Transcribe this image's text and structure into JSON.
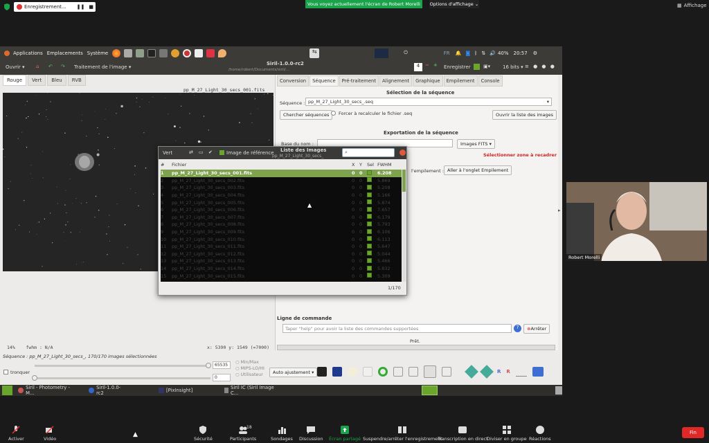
{
  "zoom": {
    "recording_label": "Enregistrement...",
    "share_banner": "Vous voyez actuellement l'écran de Robert Morelli",
    "view_options": "Options d'affichage",
    "affichage": "Affichage",
    "participant_count": "18",
    "end_label": "Fin",
    "video_name": "Robert Morelli",
    "bottom": [
      "Activer",
      "Vidéo",
      "Sécurité",
      "Participants",
      "Sondages",
      "Discussion",
      "Écran partagé",
      "Suspendre/arrêter l'enregistrement",
      "Transcription en direct",
      "Diviser en groupe",
      "Réactions"
    ]
  },
  "gnome": {
    "applications": "Applications",
    "emplacements": "Emplacements",
    "systeme": "Système",
    "lang": "FR",
    "volume": "40%",
    "clock": "20:57"
  },
  "siril": {
    "open": "Ouvrir",
    "treatment": "Traitement de l'image",
    "title": "Siril-1.0.0-rc2",
    "subtitle": "/home/robert/Documents/siril/...",
    "save": "Enregistrer",
    "bits": "16 bits",
    "channel_tabs": [
      "Rouge",
      "Vert",
      "Bleu",
      "RVB"
    ],
    "image_title": "pp_M_27_Light_30_secs_001.fits",
    "status_zoom": "14%",
    "status_fwhm": "fwhm : N/A",
    "status_coords": "x: 5390 y: 1549 (=7000)",
    "sequence_line": "Séquence : pp_M_27_Light_30_secs_, 170/170 images sélectionnées",
    "right_tabs": [
      "Conversion",
      "Séquence",
      "Pré-traitement",
      "Alignement",
      "Graphique",
      "Empilement",
      "Console"
    ],
    "sel_heading": "Sélection de la séquence",
    "seq_label": "Séquence :",
    "seq_value": "pp_M_27_Light_30_secs_.seq",
    "search_btn": "Chercher séquences",
    "force_label": "Forcer à recalculer le fichier .seq",
    "open_list_btn": "Ouvrir la liste des images",
    "export_heading": "Exportation de la séquence",
    "base_name_label": "Base du nom :",
    "fits_select": "Images FITS",
    "select_zone": "Sélectionner zone à recadrer",
    "stack_label": "l'empilement :",
    "stack_btn": "Aller à l'onglet Empilement",
    "cmd_heading": "Ligne de commande",
    "cmd_placeholder": "Taper \"help\" pour avoir la liste des commandes supportées",
    "stop_btn": "Arrêter",
    "ready": "Prêt.",
    "slider_max": "65535",
    "slider_min": "0",
    "radio_opts": [
      "Min/Max",
      "MIPS-LO/HI",
      "Utilisateur"
    ],
    "auto_adjust": "Auto ajustement",
    "tronquer": "tronquer"
  },
  "image_list": {
    "title": "Liste des Images",
    "channel": "Vert",
    "ref_label": "Image de référence",
    "subtitle": "pp_M_27_Light_30_secs_",
    "headers": [
      "#",
      "Fichier",
      "X",
      "Y",
      "Sel",
      "FWHM"
    ],
    "rows": [
      {
        "n": "1",
        "file": "pp_M_27_Light_30_secs_001.fits",
        "x": "0",
        "y": "0",
        "fwhm": "6.208",
        "sel": true
      },
      {
        "n": "2",
        "file": "pp_M_27_Light_30_secs_002.fits",
        "x": "0",
        "y": "0",
        "fwhm": "5.869",
        "sel": false
      },
      {
        "n": "3",
        "file": "pp_M_27_Light_30_secs_003.fits",
        "x": "0",
        "y": "0",
        "fwhm": "5.208",
        "sel": false
      },
      {
        "n": "4",
        "file": "pp_M_27_Light_30_secs_004.fits",
        "x": "0",
        "y": "0",
        "fwhm": "5.166",
        "sel": false
      },
      {
        "n": "5",
        "file": "pp_M_27_Light_30_secs_005.fits",
        "x": "0",
        "y": "0",
        "fwhm": "5.874",
        "sel": false
      },
      {
        "n": "6",
        "file": "pp_M_27_Light_30_secs_006.fits",
        "x": "0",
        "y": "0",
        "fwhm": "7.657",
        "sel": false
      },
      {
        "n": "7",
        "file": "pp_M_27_Light_30_secs_007.fits",
        "x": "0",
        "y": "0",
        "fwhm": "6.179",
        "sel": false
      },
      {
        "n": "8",
        "file": "pp_M_27_Light_30_secs_008.fits",
        "x": "0",
        "y": "0",
        "fwhm": "5.793",
        "sel": false
      },
      {
        "n": "9",
        "file": "pp_M_27_Light_30_secs_009.fits",
        "x": "0",
        "y": "0",
        "fwhm": "6.106",
        "sel": false
      },
      {
        "n": "10",
        "file": "pp_M_27_Light_30_secs_010.fits",
        "x": "0",
        "y": "0",
        "fwhm": "6.113",
        "sel": false
      },
      {
        "n": "11",
        "file": "pp_M_27_Light_30_secs_011.fits",
        "x": "0",
        "y": "0",
        "fwhm": "5.647",
        "sel": false
      },
      {
        "n": "12",
        "file": "pp_M_27_Light_30_secs_012.fits",
        "x": "0",
        "y": "0",
        "fwhm": "5.044",
        "sel": false
      },
      {
        "n": "13",
        "file": "pp_M_27_Light_30_secs_013.fits",
        "x": "0",
        "y": "0",
        "fwhm": "5.466",
        "sel": false
      },
      {
        "n": "14",
        "file": "pp_M_27_Light_30_secs_014.fits",
        "x": "0",
        "y": "0",
        "fwhm": "5.832",
        "sel": false
      },
      {
        "n": "15",
        "file": "pp_M_27_Light_30_secs_015.fits",
        "x": "0",
        "y": "0",
        "fwhm": "5.309",
        "sel": false
      }
    ],
    "count": "1/170"
  },
  "taskbar": [
    "Siril - Photometry - M...",
    "Siril-1.0.0-rc2",
    "[PixInsight]",
    "Siril IC (Siril Image C..."
  ]
}
